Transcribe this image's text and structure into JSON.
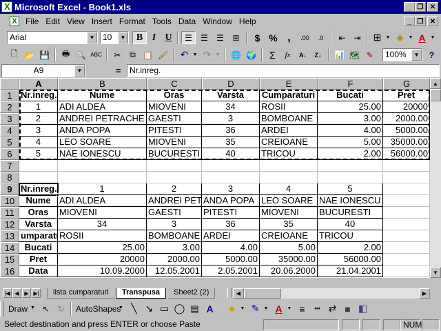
{
  "window": {
    "title": "Microsoft Excel - Book1.xls"
  },
  "menu": [
    "File",
    "Edit",
    "View",
    "Insert",
    "Format",
    "Tools",
    "Data",
    "Window",
    "Help"
  ],
  "format_toolbar": {
    "font_name": "Arial",
    "font_size": "10",
    "bold": "B",
    "italic": "I",
    "underline": "U",
    "currency": "$",
    "percent": "%",
    "comma": ",",
    "inc_decimal": ".00",
    "dec_decimal": ".0"
  },
  "standard_toolbar": {
    "zoom": "100%",
    "autosum": "Σ",
    "function": "fx"
  },
  "formula_bar": {
    "name_box": "A9",
    "equals": "=",
    "content": "Nr.inreg."
  },
  "columns": [
    "A",
    "B",
    "C",
    "D",
    "E",
    "F",
    "G"
  ],
  "rows": [
    "1",
    "2",
    "3",
    "4",
    "5",
    "6",
    "7",
    "8",
    "9",
    "10",
    "11",
    "12",
    "13",
    "14",
    "15",
    "16"
  ],
  "table1": {
    "headers": [
      "Nr.inreg.",
      "Nume",
      "Oras",
      "Varsta",
      "Cumparaturi",
      "Bucati",
      "Pret"
    ],
    "rows": [
      [
        "1",
        "ADI ALDEA",
        "MIOVENI",
        "34",
        "ROSII",
        "25.00",
        "20000"
      ],
      [
        "2",
        "ANDREI PETRACHE",
        "GAESTI",
        "3",
        "BOMBOANE",
        "3.00",
        "2000.00"
      ],
      [
        "3",
        "ANDA POPA",
        "PITESTI",
        "36",
        "ARDEI",
        "4.00",
        "5000.00"
      ],
      [
        "4",
        "LEO SOARE",
        "MIOVENI",
        "35",
        "CREIOANE",
        "5.00",
        "35000.00"
      ],
      [
        "5",
        "NAE IONESCU",
        "BUCURESTI",
        "40",
        "TRICOU",
        "2.00",
        "56000.00"
      ]
    ],
    "overflow_col_h": [
      "1",
      "1",
      "2",
      "2",
      "2"
    ]
  },
  "table2": {
    "rows": [
      [
        "Nr.inreg.",
        "1",
        "2",
        "3",
        "4",
        "5"
      ],
      [
        "Nume",
        "ADI ALDEA",
        "ANDREI PET",
        "ANDA POPA",
        "LEO SOARE",
        "NAE IONESCU"
      ],
      [
        "Oras",
        "MIOVENI",
        "GAESTI",
        "PITESTI",
        "MIOVENI",
        "BUCURESTI"
      ],
      [
        "Varsta",
        "34",
        "3",
        "36",
        "35",
        "40"
      ],
      [
        "umparatu",
        "ROSII",
        "BOMBOANE",
        "ARDEI",
        "CREIOANE",
        "TRICOU"
      ],
      [
        "Bucati",
        "25.00",
        "3.00",
        "4.00",
        "5.00",
        "2.00"
      ],
      [
        "Pret",
        "20000",
        "2000.00",
        "5000.00",
        "35000.00",
        "56000.00"
      ],
      [
        "Data",
        "10.09.2000",
        "12.05.2001",
        "2.05.2001",
        "20.06.2000",
        "21.04.2001"
      ]
    ]
  },
  "sheet_tabs": [
    "lista cumparaturi",
    "Transpusa",
    "Sheet2 (2)"
  ],
  "active_tab": "Transpusa",
  "drawing_toolbar": {
    "draw": "Draw",
    "autoshapes": "AutoShapes"
  },
  "status": {
    "message": "Select destination and press ENTER or choose Paste",
    "num": "NUM"
  }
}
